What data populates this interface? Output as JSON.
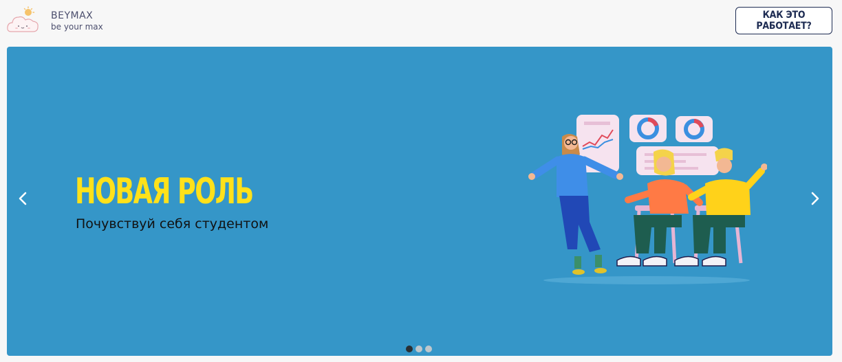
{
  "header": {
    "brand_name": "BEYMAX",
    "brand_tagline": "be your max",
    "how_it_works_label": "КАК ЭТО РАБОТАЕТ?"
  },
  "slider": {
    "current_slide": 1,
    "total_slides": 3,
    "slide": {
      "title": "НОВАЯ РОЛЬ",
      "subtitle": "Почувствуй себя студентом"
    }
  },
  "colors": {
    "page_bg": "#f7f7f7",
    "slide_bg": "#3596c8",
    "title": "#ffe11a",
    "button_border": "#1d2b52"
  },
  "icons": {
    "logo": "cloud-sun-icon",
    "prev": "chevron-left-icon",
    "next": "chevron-right-icon"
  }
}
